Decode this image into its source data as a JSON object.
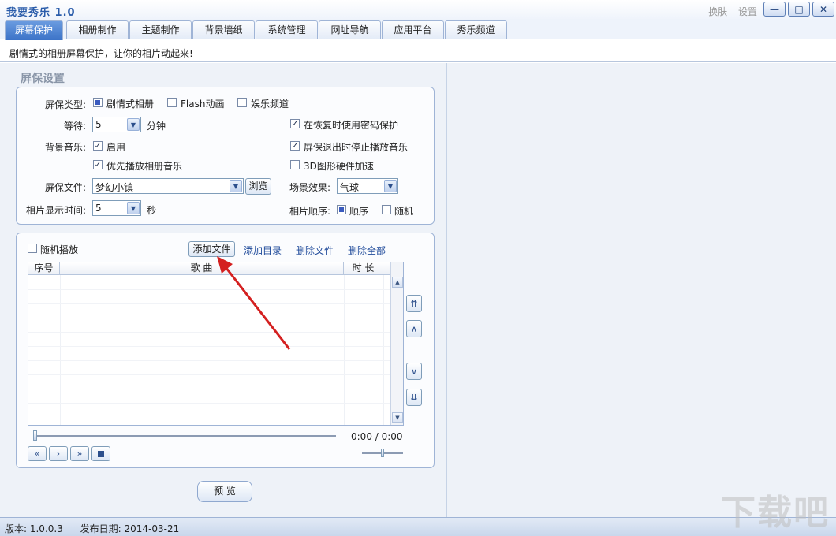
{
  "app": {
    "title": "我要秀乐 1.0",
    "skin_label": "换肤",
    "settings_label": "设置"
  },
  "window": {
    "min": "—",
    "max": "□",
    "close": "✕"
  },
  "tabs": [
    "屏幕保护",
    "相册制作",
    "主题制作",
    "背景墙纸",
    "系统管理",
    "网址导航",
    "应用平台",
    "秀乐频道"
  ],
  "active_tab": 0,
  "info_text": "剧情式的相册屏幕保护，让你的相片动起来!",
  "section_title": "屏保设置",
  "settings": {
    "type_label": "屏保类型:",
    "type_options": [
      "剧情式相册",
      "Flash动画",
      "娱乐频道"
    ],
    "wait_label": "等待:",
    "wait_value": "5",
    "wait_unit": "分钟",
    "password_label": "在恢复时使用密码保护",
    "bgm_label": "背景音乐:",
    "bgm_enable": "启用",
    "stop_music_label": "屏保退出时停止播放音乐",
    "prefer_album_music": "优先播放相册音乐",
    "hw_accel": "3D图形硬件加速",
    "file_label": "屏保文件:",
    "file_value": "梦幻小镇",
    "browse": "浏览",
    "effect_label": "场景效果:",
    "effect_value": "气球",
    "photo_time_label": "相片显示时间:",
    "photo_time_value": "5",
    "photo_time_unit": "秒",
    "order_label": "相片顺序:",
    "order_seq": "顺序",
    "order_rand": "随机"
  },
  "playlist": {
    "random_play": "随机播放",
    "add_file": "添加文件",
    "add_dir": "添加目录",
    "delete_file": "删除文件",
    "delete_all": "删除全部",
    "col_index": "序号",
    "col_song": "歌 曲",
    "col_duration": "时 长",
    "time_display": "0:00 / 0:00"
  },
  "preview_label": "预 览",
  "status": {
    "version": "版本: 1.0.0.3",
    "release": "发布日期: 2014-03-21"
  },
  "watermark": "下载吧",
  "colors": {
    "accent": "#3c73c8",
    "arrow": "#d42020"
  }
}
